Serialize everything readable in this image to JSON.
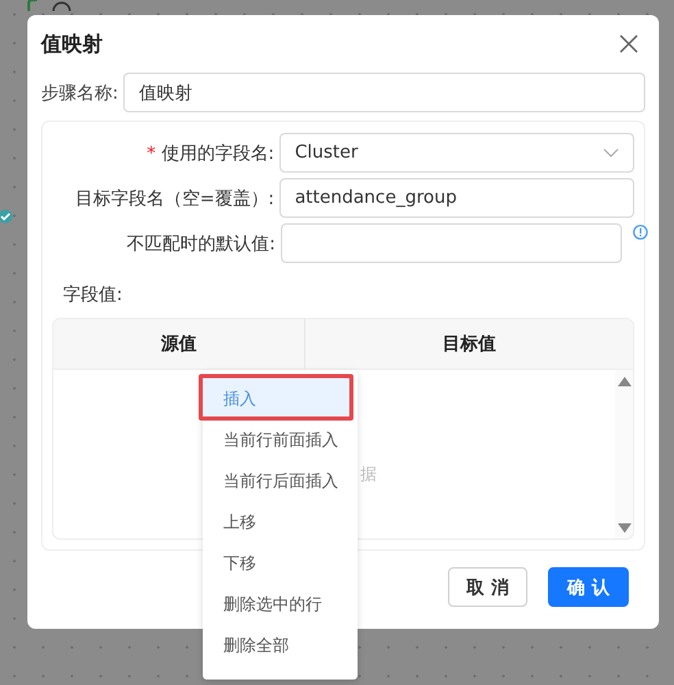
{
  "dialog": {
    "title": "值映射",
    "step_name": {
      "label": "步骤名称:",
      "value": "值映射"
    },
    "fields": [
      {
        "kind": "select",
        "required_mark": "*",
        "label": "使用的字段名:",
        "value": "Cluster"
      },
      {
        "kind": "text",
        "label": "目标字段名（空=覆盖）:",
        "value": "attendance_group"
      },
      {
        "kind": "text",
        "label": "不匹配时的默认值:",
        "info": true
      }
    ],
    "table": {
      "label": "字段值:",
      "columns": [
        "源值",
        "目标值"
      ],
      "empty_text": "据"
    },
    "buttons": [
      {
        "label": "取 消",
        "primary": false
      },
      {
        "label": "确 认",
        "primary": true
      }
    ]
  },
  "context_menu": [
    {
      "label": "插入",
      "selected": true,
      "outlined": true
    },
    {
      "label": "当前行前面插入",
      "selected": false,
      "outlined": false
    },
    {
      "label": "当前行后面插入",
      "selected": false,
      "outlined": false
    },
    {
      "label": "上移",
      "selected": false,
      "outlined": false
    },
    {
      "label": "下移",
      "selected": false,
      "outlined": false
    },
    {
      "label": "删除选中的行",
      "selected": false,
      "outlined": false
    },
    {
      "label": "删除全部",
      "selected": false,
      "outlined": false
    }
  ]
}
